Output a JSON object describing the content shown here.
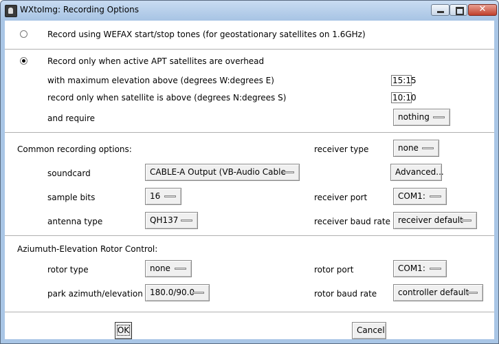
{
  "window": {
    "title": "WXtoImg: Recording Options"
  },
  "recording": {
    "wefax_label": "Record using WEFAX start/stop tones (for geostationary satellites on 1.6GHz)",
    "apt_label": "Record only when active APT satellites are overhead",
    "max_elev_label": "with maximum elevation above (degrees W:degrees E)",
    "max_elev_value": "15:15",
    "above_label": "record only when satellite is above (degrees N:degrees S)",
    "above_value": "10:10",
    "require_label": "and require",
    "require_value": "nothing"
  },
  "common": {
    "heading": "Common recording options:",
    "soundcard_label": "soundcard",
    "soundcard_value": "CABLE-A Output (VB-Audio Cable",
    "sample_bits_label": "sample bits",
    "sample_bits_value": "16",
    "antenna_label": "antenna type",
    "antenna_value": "QH137",
    "receiver_type_label": "receiver type",
    "receiver_type_value": "none",
    "advanced_label": "Advanced...",
    "receiver_port_label": "receiver port",
    "receiver_port_value": "COM1:",
    "receiver_baud_label": "receiver baud rate",
    "receiver_baud_value": "receiver default"
  },
  "rotor": {
    "heading": "Aziumuth-Elevation Rotor Control:",
    "type_label": "rotor type",
    "type_value": "none",
    "park_label": "park azimuth/elevation",
    "park_value": "180.0/90.0",
    "port_label": "rotor port",
    "port_value": "COM1:",
    "baud_label": "rotor baud rate",
    "baud_value": "controller default"
  },
  "footer": {
    "ok_label": "OK",
    "cancel_label": "Cancel"
  }
}
